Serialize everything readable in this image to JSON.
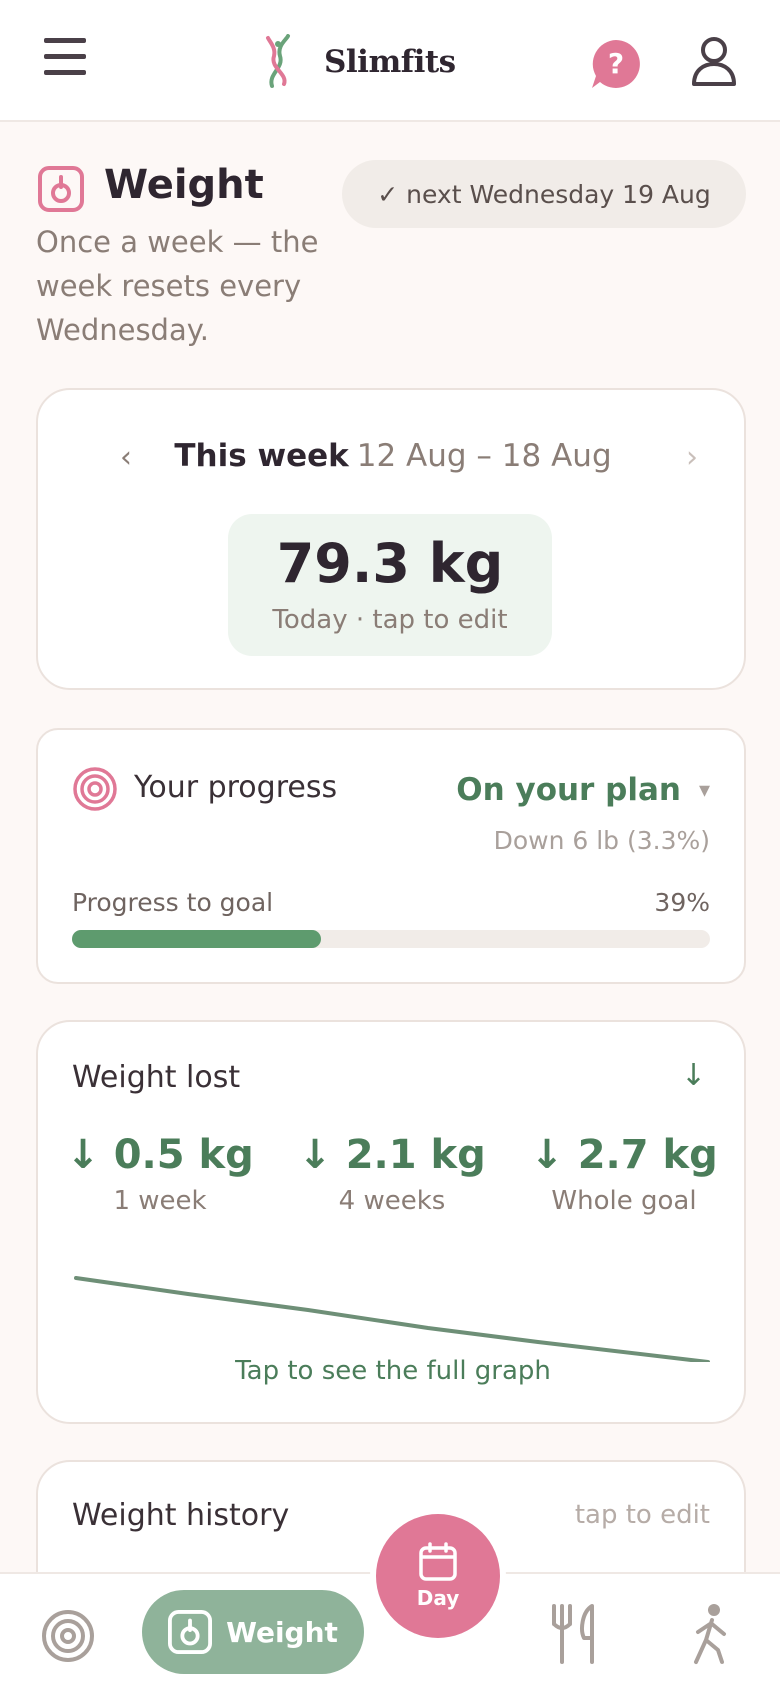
{
  "header": {
    "app_name": "Slimfits"
  },
  "page": {
    "title": "Weight",
    "subtitle": "Once a week — the week resets every Wednesday.",
    "next_pill": "✓ next Wednesday 19 Aug"
  },
  "week_card": {
    "prev_symbol": "‹",
    "next_symbol": "›",
    "label": "This week",
    "range": "12 Aug – 18 Aug",
    "weight": "79.3 kg",
    "hint": "Today · tap to edit"
  },
  "progress_card": {
    "title": "Your progress",
    "status": "On your plan",
    "status_caret": "▾",
    "down": "Down 6 lb (3.3%)",
    "goal_label": "Progress to goal",
    "goal_pct_text": "39%",
    "goal_fraction": 0.39
  },
  "lost_card": {
    "title": "Weight lost",
    "toggle_symbol": "↓",
    "stats": [
      {
        "value": "↓ 0.5 kg",
        "label": "1 week"
      },
      {
        "value": "↓ 2.1 kg",
        "label": "4 weeks"
      },
      {
        "value": "↓ 2.7 kg",
        "label": "Whole goal"
      }
    ],
    "graph_link": "Tap to see the full graph"
  },
  "history_card": {
    "title": "Weight history",
    "hint": "tap to edit"
  },
  "bottom_nav": {
    "weight_label": "Weight",
    "day_label": "Day"
  },
  "colors": {
    "accent_pink": "#e07896",
    "accent_green": "#4b7d5a",
    "progress_fill": "#5e9b6e",
    "nav_active": "#8fb39a"
  }
}
